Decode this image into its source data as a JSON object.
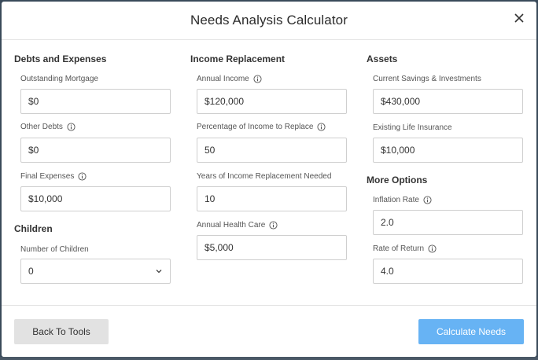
{
  "dialog": {
    "title": "Needs Analysis Calculator"
  },
  "debts": {
    "title": "Debts and Expenses",
    "mortgage_label": "Outstanding Mortgage",
    "mortgage_value": "$0",
    "other_label": "Other Debts",
    "other_value": "$0",
    "final_label": "Final Expenses",
    "final_value": "$10,000"
  },
  "children": {
    "title": "Children",
    "count_label": "Number of Children",
    "count_value": "0"
  },
  "income": {
    "title": "Income Replacement",
    "annual_label": "Annual Income",
    "annual_value": "$120,000",
    "pct_label": "Percentage of Income to Replace",
    "pct_value": "50",
    "years_label": "Years of Income Replacement Needed",
    "years_value": "10",
    "health_label": "Annual Health Care",
    "health_value": "$5,000"
  },
  "assets": {
    "title": "Assets",
    "savings_label": "Current Savings & Investments",
    "savings_value": "$430,000",
    "insurance_label": "Existing Life Insurance",
    "insurance_value": "$10,000"
  },
  "options": {
    "title": "More Options",
    "inflation_label": "Inflation Rate",
    "inflation_value": "2.0",
    "return_label": "Rate of Return",
    "return_value": "4.0"
  },
  "footer": {
    "back_label": "Back To Tools",
    "calc_label": "Calculate Needs"
  },
  "colors": {
    "primary": "#67b3f4",
    "secondary": "#e2e2e2"
  }
}
